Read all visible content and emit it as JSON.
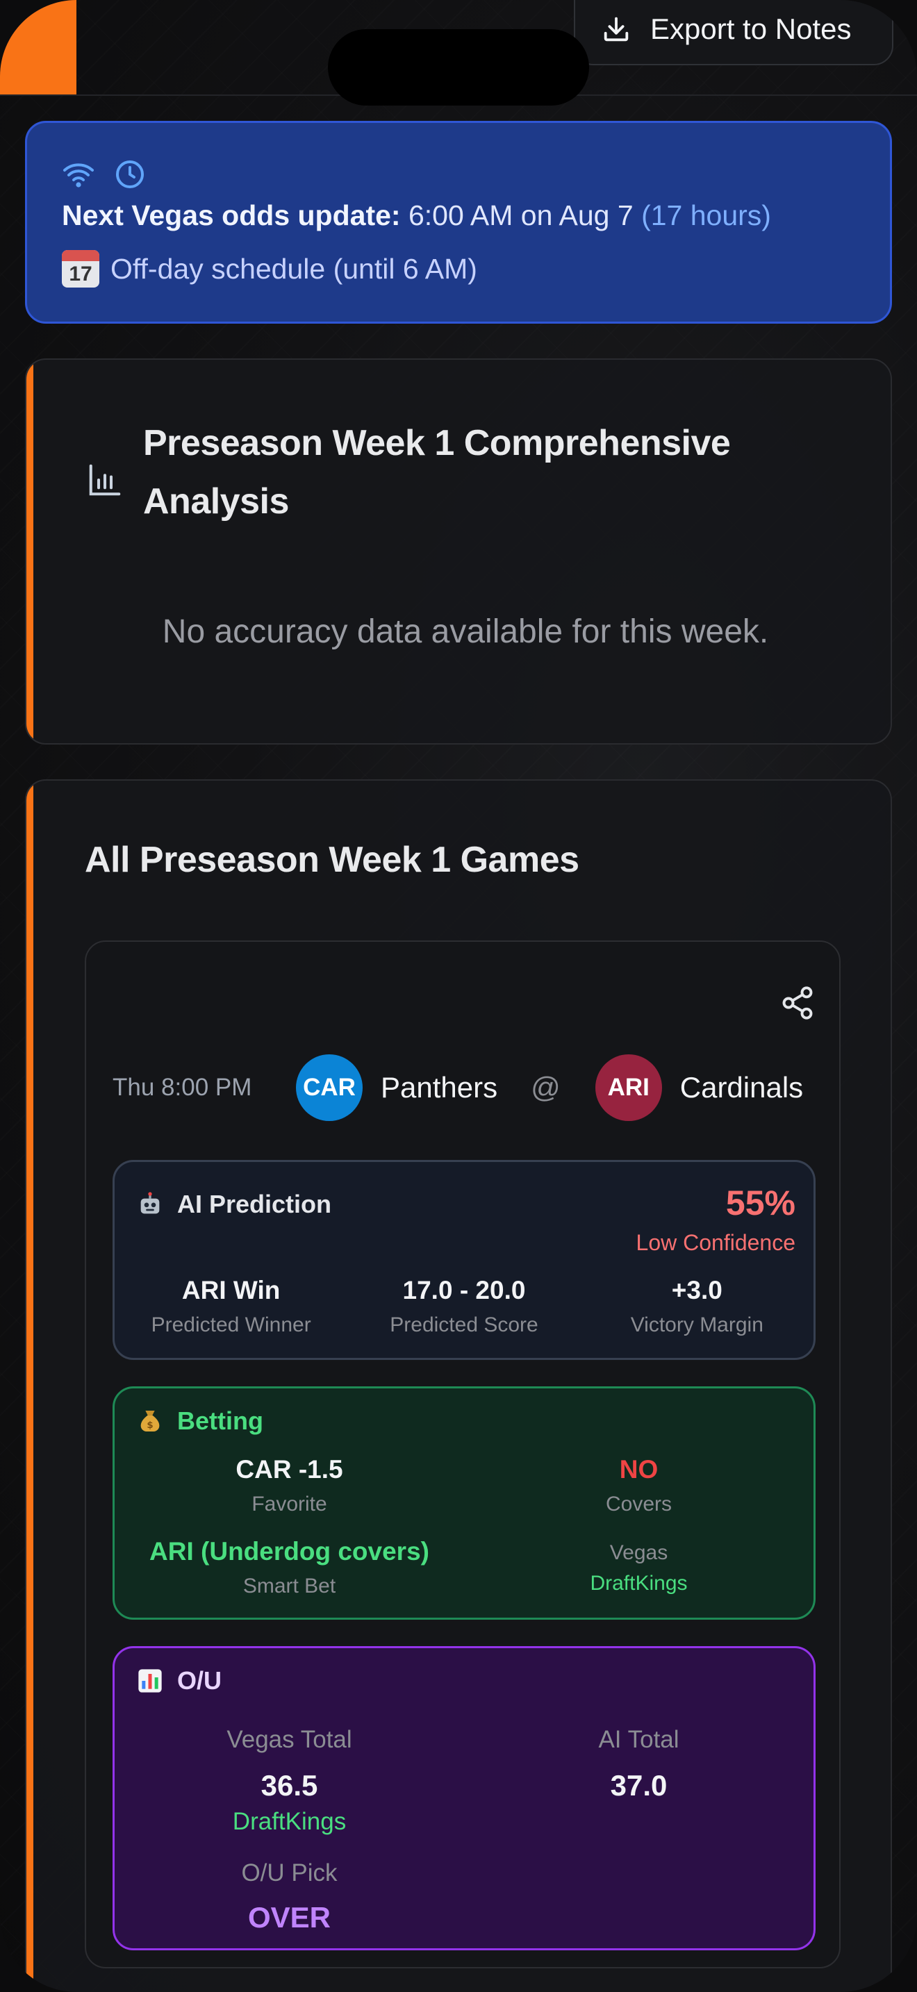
{
  "header": {
    "export_label": "Export to Notes"
  },
  "odds_banner": {
    "label": "Next Vegas odds update:",
    "time_text": "6:00 AM on Aug 7",
    "countdown": "(17 hours)",
    "calendar_day": "17",
    "schedule_text": "Off-day schedule (until 6 AM)"
  },
  "analysis_card": {
    "title": "Preseason Week 1 Comprehensive Analysis",
    "empty_text": "No accuracy data available for this week."
  },
  "games_card": {
    "title": "All Preseason Week 1 Games",
    "game": {
      "time": "Thu 8:00 PM",
      "away": {
        "abbr": "CAR",
        "name": "Panthers",
        "color": "#0b84d6"
      },
      "at": "@",
      "home": {
        "abbr": "ARI",
        "name": "Cardinals",
        "color": "#97233f"
      },
      "ai_prediction": {
        "title": "AI Prediction",
        "confidence_pct": "55%",
        "confidence_label": "Low Confidence",
        "winner_value": "ARI Win",
        "winner_label": "Predicted Winner",
        "score_value": "17.0 - 20.0",
        "score_label": "Predicted Score",
        "margin_value": "+3.0",
        "margin_label": "Victory Margin"
      },
      "betting": {
        "title": "Betting",
        "favorite_value": "CAR -1.5",
        "favorite_label": "Favorite",
        "covers_value": "NO",
        "covers_label": "Covers",
        "smart_bet_value": "ARI (Underdog covers)",
        "smart_bet_label": "Smart Bet",
        "vegas_label": "Vegas",
        "vegas_source": "DraftKings"
      },
      "over_under": {
        "title": "O/U",
        "vegas_total_label": "Vegas Total",
        "vegas_total_value": "36.5",
        "vegas_total_source": "DraftKings",
        "ai_total_label": "AI Total",
        "ai_total_value": "37.0",
        "pick_label": "O/U Pick",
        "pick_value": "OVER"
      }
    }
  }
}
